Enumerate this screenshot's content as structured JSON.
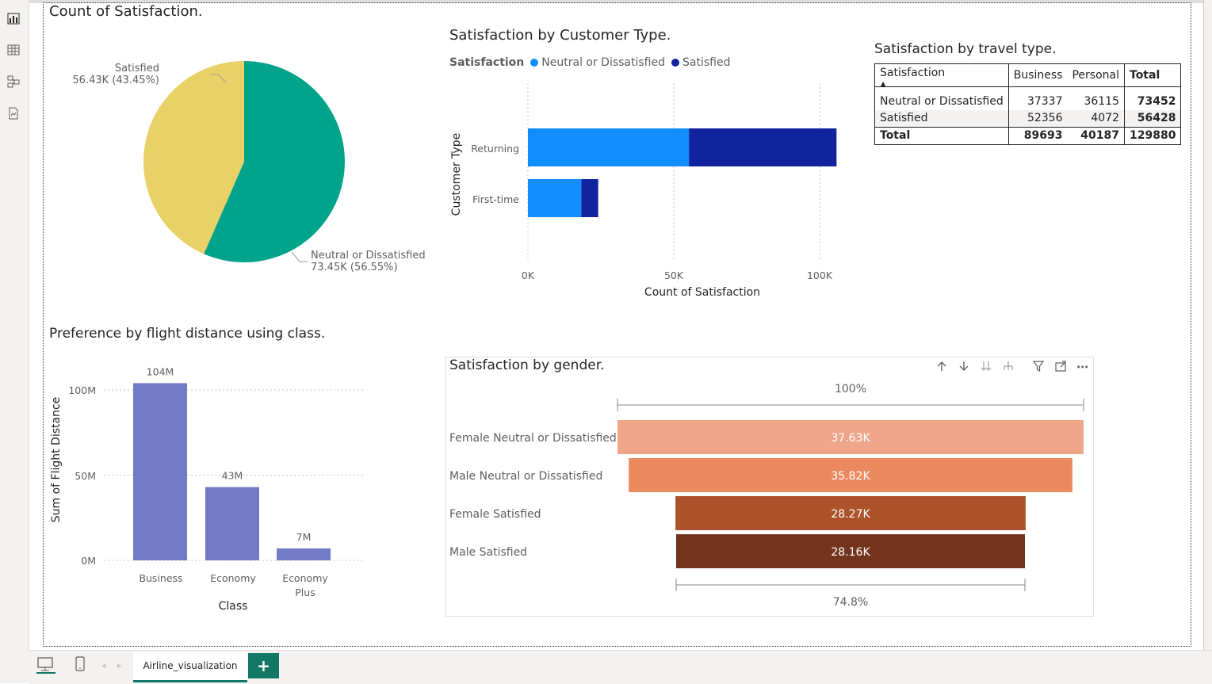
{
  "colors": {
    "pie_neutral": "#01A38A",
    "pie_satisfied": "#E8D166",
    "neutral_blue": "#118DFF",
    "satisfied_navy": "#12239E",
    "class_bar": "#737BC7",
    "funnel": [
      "#EFA68A",
      "#EC8A5F",
      "#AC522A",
      "#73341E"
    ],
    "accent": "#117865"
  },
  "sidebar": {
    "icons": [
      "report-view-icon",
      "table-view-icon",
      "model-view-icon",
      "dax-query-icon"
    ]
  },
  "pie_chart": {
    "title": "Count of Satisfaction.",
    "labels": [
      {
        "name": "Satisfied",
        "value": "56.43K (43.45%)"
      },
      {
        "name": "Neutral or Dissatisfied",
        "value": "73.45K (56.55%)"
      }
    ]
  },
  "customer_type_chart": {
    "title": "Satisfaction by Customer Type.",
    "legend_title": "Satisfaction",
    "legend": [
      "Neutral or Dissatisfied",
      "Satisfied"
    ],
    "ylabel": "Customer Type",
    "xlabel": "Count of Satisfaction",
    "ticks": [
      "0K",
      "50K",
      "100K"
    ],
    "categories": [
      "Returning",
      "First-time"
    ]
  },
  "travel_matrix": {
    "title": "Satisfaction by travel type.",
    "headers": [
      "Satisfaction",
      "Business",
      "Personal",
      "Total"
    ],
    "rows": [
      [
        "Neutral or Dissatisfied",
        "37337",
        "36115",
        "73452"
      ],
      [
        "Satisfied",
        "52356",
        "4072",
        "56428"
      ],
      [
        "Total",
        "89693",
        "40187",
        "129880"
      ]
    ]
  },
  "class_chart": {
    "title": "Preference by flight distance using class.",
    "ylabel": "Sum of Flight Distance",
    "xlabel": "Class",
    "yticks": [
      "0M",
      "50M",
      "100M"
    ],
    "categories": [
      "Business",
      "Economy",
      "Economy Plus"
    ],
    "labels": [
      "104M",
      "43M",
      "7M"
    ]
  },
  "gender_funnel": {
    "title": "Satisfaction by gender.",
    "top_pct": "100%",
    "bottom_pct": "74.8%",
    "stages": [
      {
        "label": "Female Neutral or Dissatisfied",
        "value": "37.63K"
      },
      {
        "label": "Male Neutral or Dissatisfied",
        "value": "35.82K"
      },
      {
        "label": "Female Satisfied",
        "value": "28.27K"
      },
      {
        "label": "Male Satisfied",
        "value": "28.16K"
      }
    ]
  },
  "bottom": {
    "tab_name": "Airline_visualization",
    "add_label": "+"
  },
  "chart_data": [
    {
      "type": "pie",
      "title": "Count of Satisfaction.",
      "categories": [
        "Neutral or Dissatisfied",
        "Satisfied"
      ],
      "values": [
        73450,
        56430
      ],
      "percent": [
        56.55,
        43.45
      ]
    },
    {
      "type": "bar",
      "orientation": "horizontal",
      "stacked": true,
      "title": "Satisfaction by Customer Type.",
      "categories": [
        "Returning",
        "First-time"
      ],
      "series": [
        {
          "name": "Neutral or Dissatisfied",
          "values": [
            55200,
            18300
          ]
        },
        {
          "name": "Satisfied",
          "values": [
            50600,
            5800
          ]
        }
      ],
      "xlabel": "Count of Satisfaction",
      "ylabel": "Customer Type",
      "xlim": [
        0,
        100000
      ],
      "grid": true,
      "legend": "top-left"
    },
    {
      "type": "table",
      "title": "Satisfaction by travel type.",
      "columns": [
        "Satisfaction",
        "Business",
        "Personal",
        "Total"
      ],
      "rows": [
        [
          "Neutral or Dissatisfied",
          37337,
          36115,
          73452
        ],
        [
          "Satisfied",
          52356,
          4072,
          56428
        ],
        [
          "Total",
          89693,
          40187,
          129880
        ]
      ]
    },
    {
      "type": "bar",
      "title": "Preference by flight distance using class.",
      "categories": [
        "Business",
        "Economy",
        "Economy Plus"
      ],
      "values": [
        104,
        43,
        7
      ],
      "unit": "M",
      "xlabel": "Class",
      "ylabel": "Sum of Flight Distance",
      "ylim": [
        0,
        100
      ],
      "grid": true
    },
    {
      "type": "bar",
      "subtype": "funnel",
      "title": "Satisfaction by gender.",
      "categories": [
        "Female Neutral or Dissatisfied",
        "Male Neutral or Dissatisfied",
        "Female Satisfied",
        "Male Satisfied"
      ],
      "values": [
        37630,
        35820,
        28270,
        28160
      ],
      "top_percent": 100,
      "bottom_percent": 74.8
    }
  ]
}
